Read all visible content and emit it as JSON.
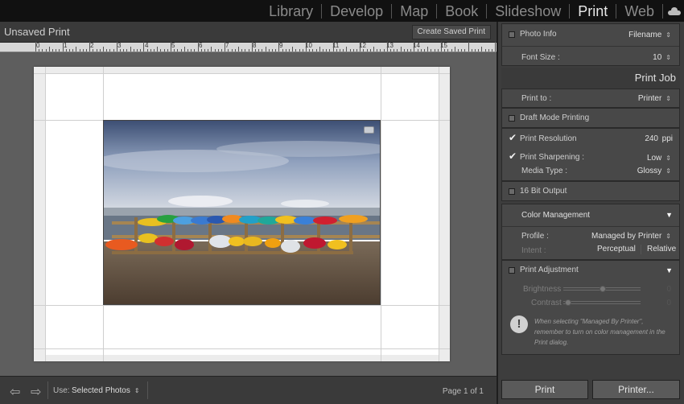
{
  "modules": [
    "Library",
    "Develop",
    "Map",
    "Book",
    "Slideshow",
    "Print",
    "Web"
  ],
  "active_module": "Print",
  "header": {
    "title": "Unsaved Print",
    "create_saved_print": "Create Saved Print"
  },
  "ruler_labels": [
    "0",
    "1",
    "2",
    "3",
    "4",
    "5",
    "6",
    "7",
    "8",
    "9",
    "10",
    "11",
    "12",
    "13",
    "14",
    "15"
  ],
  "bottombar": {
    "use_label": "Use:",
    "use_value": "Selected Photos",
    "page_indicator": "Page 1 of 1"
  },
  "panel": {
    "photo_info_label": "Photo Info",
    "photo_info_value": "Filename",
    "font_size_label": "Font Size :",
    "font_size_value": "10",
    "print_job_title": "Print Job",
    "print_to_label": "Print to :",
    "print_to_value": "Printer",
    "draft_mode": "Draft Mode Printing",
    "print_resolution": "Print Resolution",
    "print_resolution_value": "240",
    "print_resolution_unit": "ppi",
    "print_sharpening": "Print Sharpening :",
    "print_sharpening_value": "Low",
    "media_type_label": "Media Type :",
    "media_type_value": "Glossy",
    "bit_output": "16 Bit Output",
    "color_management": "Color Management",
    "profile_label": "Profile :",
    "profile_value": "Managed by Printer",
    "intent_label": "Intent :",
    "intent_perceptual": "Perceptual",
    "intent_relative": "Relative",
    "print_adjustment": "Print Adjustment",
    "brightness_label": "Brightness",
    "brightness_value": "0",
    "contrast_label": "Contrast",
    "contrast_value": "0",
    "info_line1": "When selecting \"Managed By Printer\",",
    "info_line2": "remember to turn on color management in the",
    "info_line3": "Print dialog.",
    "print_button": "Print",
    "printer_button": "Printer..."
  }
}
